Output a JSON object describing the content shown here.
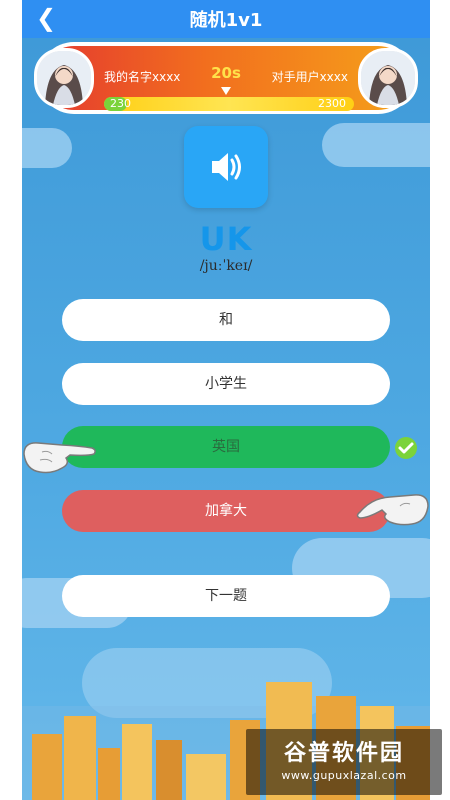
{
  "header": {
    "title": "随机1v1",
    "back_icon": "chevron-left-icon"
  },
  "battle": {
    "my_name": "我的名字xxxx",
    "opponent_name": "对手用户xxxx",
    "timer": "20s",
    "my_score": "230",
    "opponent_score": "2300",
    "my_score_fraction": 0.09,
    "colors": {
      "bar_left": "#e43a2f",
      "bar_right": "#f5a11a",
      "timer": "#ffe14a"
    }
  },
  "question": {
    "sound_icon": "speaker-icon",
    "word": "UK",
    "phonetic": "/juːˈkeɪ/"
  },
  "options": [
    {
      "label": "和",
      "state": "normal"
    },
    {
      "label": "小学生",
      "state": "normal"
    },
    {
      "label": "英国",
      "state": "correct"
    },
    {
      "label": "加拿大",
      "state": "wrong"
    }
  ],
  "next_label": "下一题",
  "watermark": {
    "title": "谷普软件园",
    "url": "www.gupuxlazal.com"
  }
}
